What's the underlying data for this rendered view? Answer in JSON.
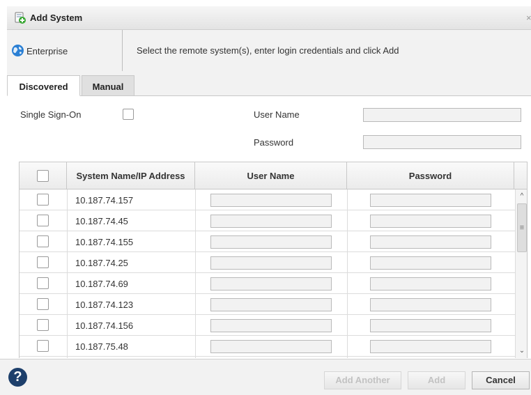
{
  "dialog": {
    "title": "Add System",
    "close_glyph": "×",
    "context_label": "Enterprise",
    "instruction": "Select the remote system(s), enter login credentials and click Add"
  },
  "tabs": [
    {
      "label": "Discovered",
      "active": true
    },
    {
      "label": "Manual",
      "active": false
    }
  ],
  "form": {
    "sso_label": "Single Sign-On",
    "username_label": "User Name",
    "password_label": "Password",
    "username_value": "",
    "password_value": ""
  },
  "table": {
    "headers": {
      "system": "System Name/IP Address",
      "username": "User Name",
      "password": "Password"
    },
    "rows": [
      {
        "ip": "10.187.74.157"
      },
      {
        "ip": "10.187.74.45"
      },
      {
        "ip": "10.187.74.155"
      },
      {
        "ip": "10.187.74.25"
      },
      {
        "ip": "10.187.74.69"
      },
      {
        "ip": "10.187.74.123"
      },
      {
        "ip": "10.187.74.156"
      },
      {
        "ip": "10.187.75.48"
      },
      {
        "ip": ""
      }
    ]
  },
  "scroll": {
    "up": "^",
    "down": "⌄",
    "grip": "≡"
  },
  "footer": {
    "help_glyph": "?",
    "add_another_label": "Add Another",
    "add_label": "Add",
    "cancel_label": "Cancel"
  },
  "icons": {
    "app": "add-system-icon",
    "context": "globe-icon",
    "help": "help-icon"
  },
  "colors": {
    "help_circle": "#1d3f6b",
    "globe": "#2a7fd4",
    "add_badge": "#3aa835"
  }
}
